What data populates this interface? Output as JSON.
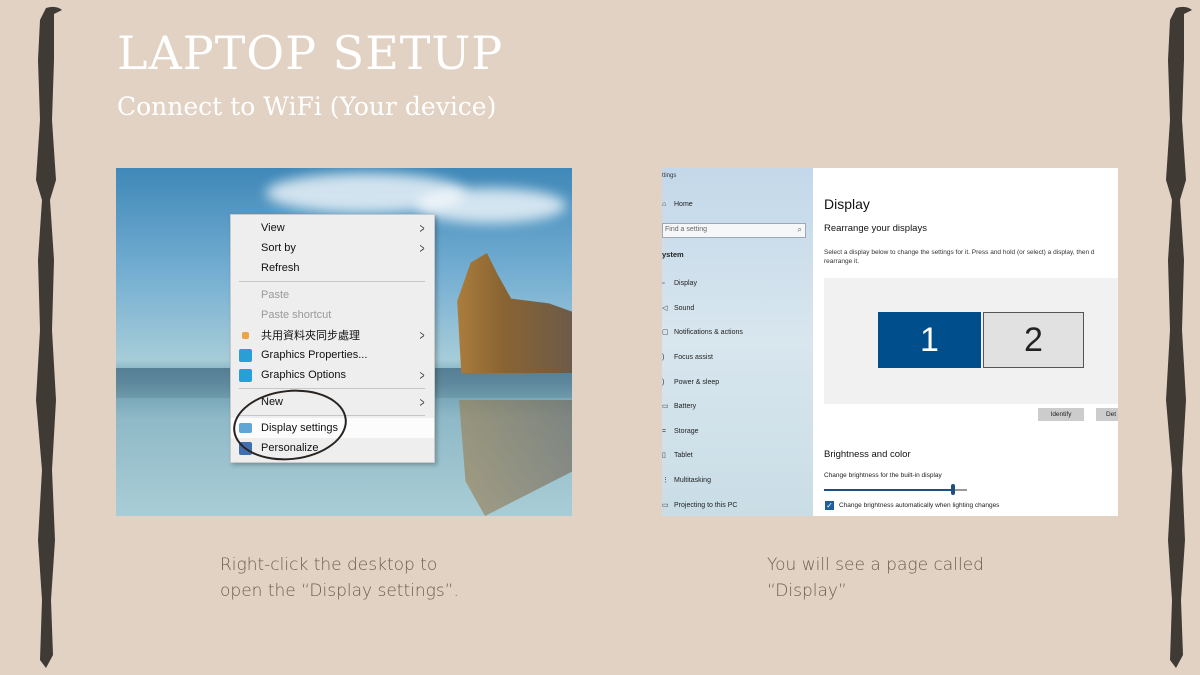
{
  "slide": {
    "title": "LAPTOP SETUP",
    "subtitle": "Connect to WiFi (Your device)",
    "background_color": "#e2d2c3"
  },
  "left_panel": {
    "context_menu": {
      "items": [
        {
          "label": "View",
          "submenu": true,
          "disabled": false,
          "icon": null
        },
        {
          "label": "Sort by",
          "submenu": true,
          "disabled": false,
          "icon": null
        },
        {
          "label": "Refresh",
          "submenu": false,
          "disabled": false,
          "icon": null
        },
        {
          "label": "Paste",
          "submenu": false,
          "disabled": true,
          "icon": null
        },
        {
          "label": "Paste shortcut",
          "submenu": false,
          "disabled": true,
          "icon": null
        },
        {
          "label": "共用資料夾同步處理",
          "submenu": true,
          "disabled": false,
          "icon": "sync-folder-icon"
        },
        {
          "label": "Graphics Properties...",
          "submenu": false,
          "disabled": false,
          "icon": "graphics-icon"
        },
        {
          "label": "Graphics Options",
          "submenu": true,
          "disabled": false,
          "icon": "graphics-icon"
        },
        {
          "label": "New",
          "submenu": true,
          "disabled": false,
          "icon": null
        },
        {
          "label": "Display settings",
          "submenu": false,
          "disabled": false,
          "icon": "monitor-icon",
          "highlighted": true
        },
        {
          "label": "Personalize",
          "submenu": false,
          "disabled": false,
          "icon": "personalize-icon"
        }
      ]
    },
    "caption_line1": "Right-click the desktop to",
    "caption_line2": "open the “Display settings”."
  },
  "right_panel": {
    "window_title": "ttings",
    "nav": {
      "home": "Home",
      "search_placeholder": "Find a setting",
      "section": "ystem",
      "items": [
        "Display",
        "Sound",
        "Notifications & actions",
        "Focus assist",
        "Power & sleep",
        "Battery",
        "Storage",
        "Tablet",
        "Multitasking",
        "Projecting to this PC"
      ]
    },
    "main": {
      "title": "Display",
      "rearrange_heading": "Rearrange your displays",
      "rearrange_desc": "Select a display below to change the settings for it. Press and hold (or select) a display, then d\nrearrange it.",
      "display1": "1",
      "display2": "2",
      "identify_button": "Identify",
      "detect_button": "Det",
      "brightness_heading": "Brightness and color",
      "brightness_label": "Change brightness for the built-in display",
      "brightness_value_percent": 90,
      "auto_brightness_label": "Change brightness automatically when lighting changes",
      "auto_brightness_checked": true,
      "accent_color": "#004e8c"
    },
    "caption_line1": "You will see a page called",
    "caption_line2": "“Display”"
  }
}
